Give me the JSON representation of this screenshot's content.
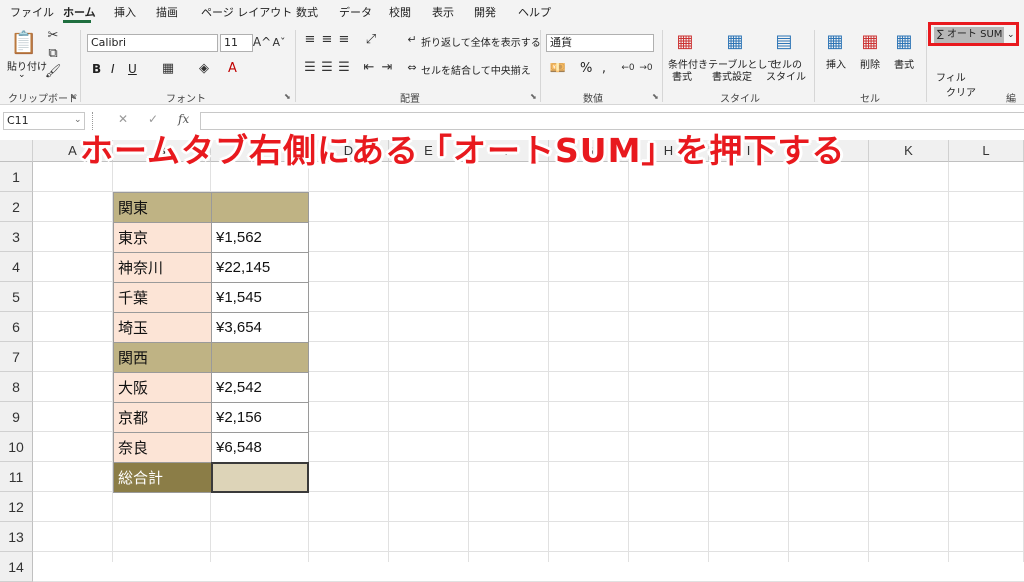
{
  "tabs": [
    "ファイル",
    "ホーム",
    "挿入",
    "描画",
    "ページ レイアウト",
    "数式",
    "データ",
    "校閲",
    "表示",
    "開発",
    "ヘルプ"
  ],
  "ribbon": {
    "clipboard": {
      "paste_label": "貼り付け",
      "group_label": "クリップボード"
    },
    "font": {
      "font_name": "Calibri",
      "font_size": "11",
      "bold": "B",
      "italic": "I",
      "underline": "U",
      "font_color_glyph": "A",
      "group_label": "フォント"
    },
    "alignment": {
      "wrap_text": "折り返して全体を表示する",
      "merge_center": "セルを結合して中央揃え",
      "group_label": "配置"
    },
    "number": {
      "format": "通貨",
      "percent": "%",
      "group_label": "数値"
    },
    "styles": {
      "conditional": "条件付き",
      "conditional2": "書式",
      "table": "テーブルとして",
      "table2": "書式設定",
      "cell": "セルの",
      "cell2": "スタイル",
      "group_label": "スタイル"
    },
    "cells": {
      "insert": "挿入",
      "delete": "削除",
      "format": "書式",
      "group_label": "セル"
    },
    "editing": {
      "autosum": "オート SUM",
      "fill": "フィル",
      "clear": "クリア",
      "group_label": "編"
    }
  },
  "formula_bar": {
    "name_box": "C11",
    "cancel": "✕",
    "enter": "✓",
    "fx": "fx",
    "value": ""
  },
  "columns": [
    "A",
    "B",
    "C",
    "D",
    "E",
    "F",
    "G",
    "H",
    "I",
    "J",
    "K",
    "L"
  ],
  "rows": [
    "1",
    "2",
    "3",
    "4",
    "5",
    "6",
    "7",
    "8",
    "9",
    "10",
    "11",
    "12",
    "13",
    "14"
  ],
  "table": [
    {
      "label": "関東",
      "value": "",
      "type": "region"
    },
    {
      "label": "東京",
      "value": "¥1,562",
      "type": "pref"
    },
    {
      "label": "神奈川",
      "value": "¥22,145",
      "type": "pref"
    },
    {
      "label": "千葉",
      "value": "¥1,545",
      "type": "pref"
    },
    {
      "label": "埼玉",
      "value": "¥3,654",
      "type": "pref"
    },
    {
      "label": "関西",
      "value": "",
      "type": "region"
    },
    {
      "label": "大阪",
      "value": "¥2,542",
      "type": "pref"
    },
    {
      "label": "京都",
      "value": "¥2,156",
      "type": "pref"
    },
    {
      "label": "奈良",
      "value": "¥6,548",
      "type": "pref"
    },
    {
      "label": "総合計",
      "value": "",
      "type": "total"
    }
  ],
  "annotation": {
    "text": "ホームタブ右側にある「オートSUM」を押下する",
    "color": "#e8191e"
  },
  "colors": {
    "region": "#bfb384",
    "prefecture": "#fce4d6",
    "total_label": "#8b7d47",
    "total_value": "#ddd4b8",
    "highlight": "#e8191e",
    "accent": "#1f6f3f"
  }
}
